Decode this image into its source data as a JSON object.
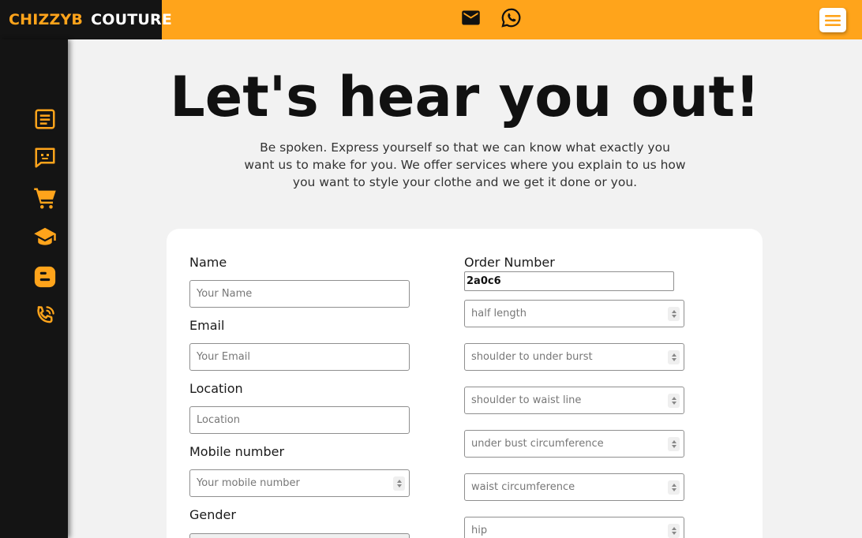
{
  "brand": {
    "part1": "CHIZZYB",
    "part2": "COUTURE",
    "accent": "#ffa41b",
    "dark": "#141414"
  },
  "topbar": {
    "icons": [
      "mail-icon",
      "whatsapp-icon"
    ],
    "menu_icon": "hamburger-menu-icon"
  },
  "sidebar": {
    "items": [
      "list-icon",
      "chat-icon",
      "cart-icon",
      "graduation-cap-icon",
      "blogger-icon",
      "phone-call-icon"
    ]
  },
  "hero": {
    "title": "Let's hear you out!",
    "subtitle": "Be spoken. Express yourself so that we can know what exactly you want us to make for you. We offer services where you explain to us how you want to style your clothe and we get it done or you."
  },
  "form": {
    "name_label": "Name",
    "name_placeholder": "Your Name",
    "email_label": "Email",
    "email_placeholder": "Your Email",
    "location_label": "Location",
    "location_placeholder": "Location",
    "mobile_label": "Mobile number",
    "mobile_placeholder": "Your mobile number",
    "gender_label": "Gender",
    "order_label": "Order Number",
    "order_value": "2a0c6",
    "measurements": [
      "half length",
      "shoulder to under burst",
      "shoulder to waist line",
      "under bust circumference",
      "waist circumference",
      "hip"
    ]
  }
}
